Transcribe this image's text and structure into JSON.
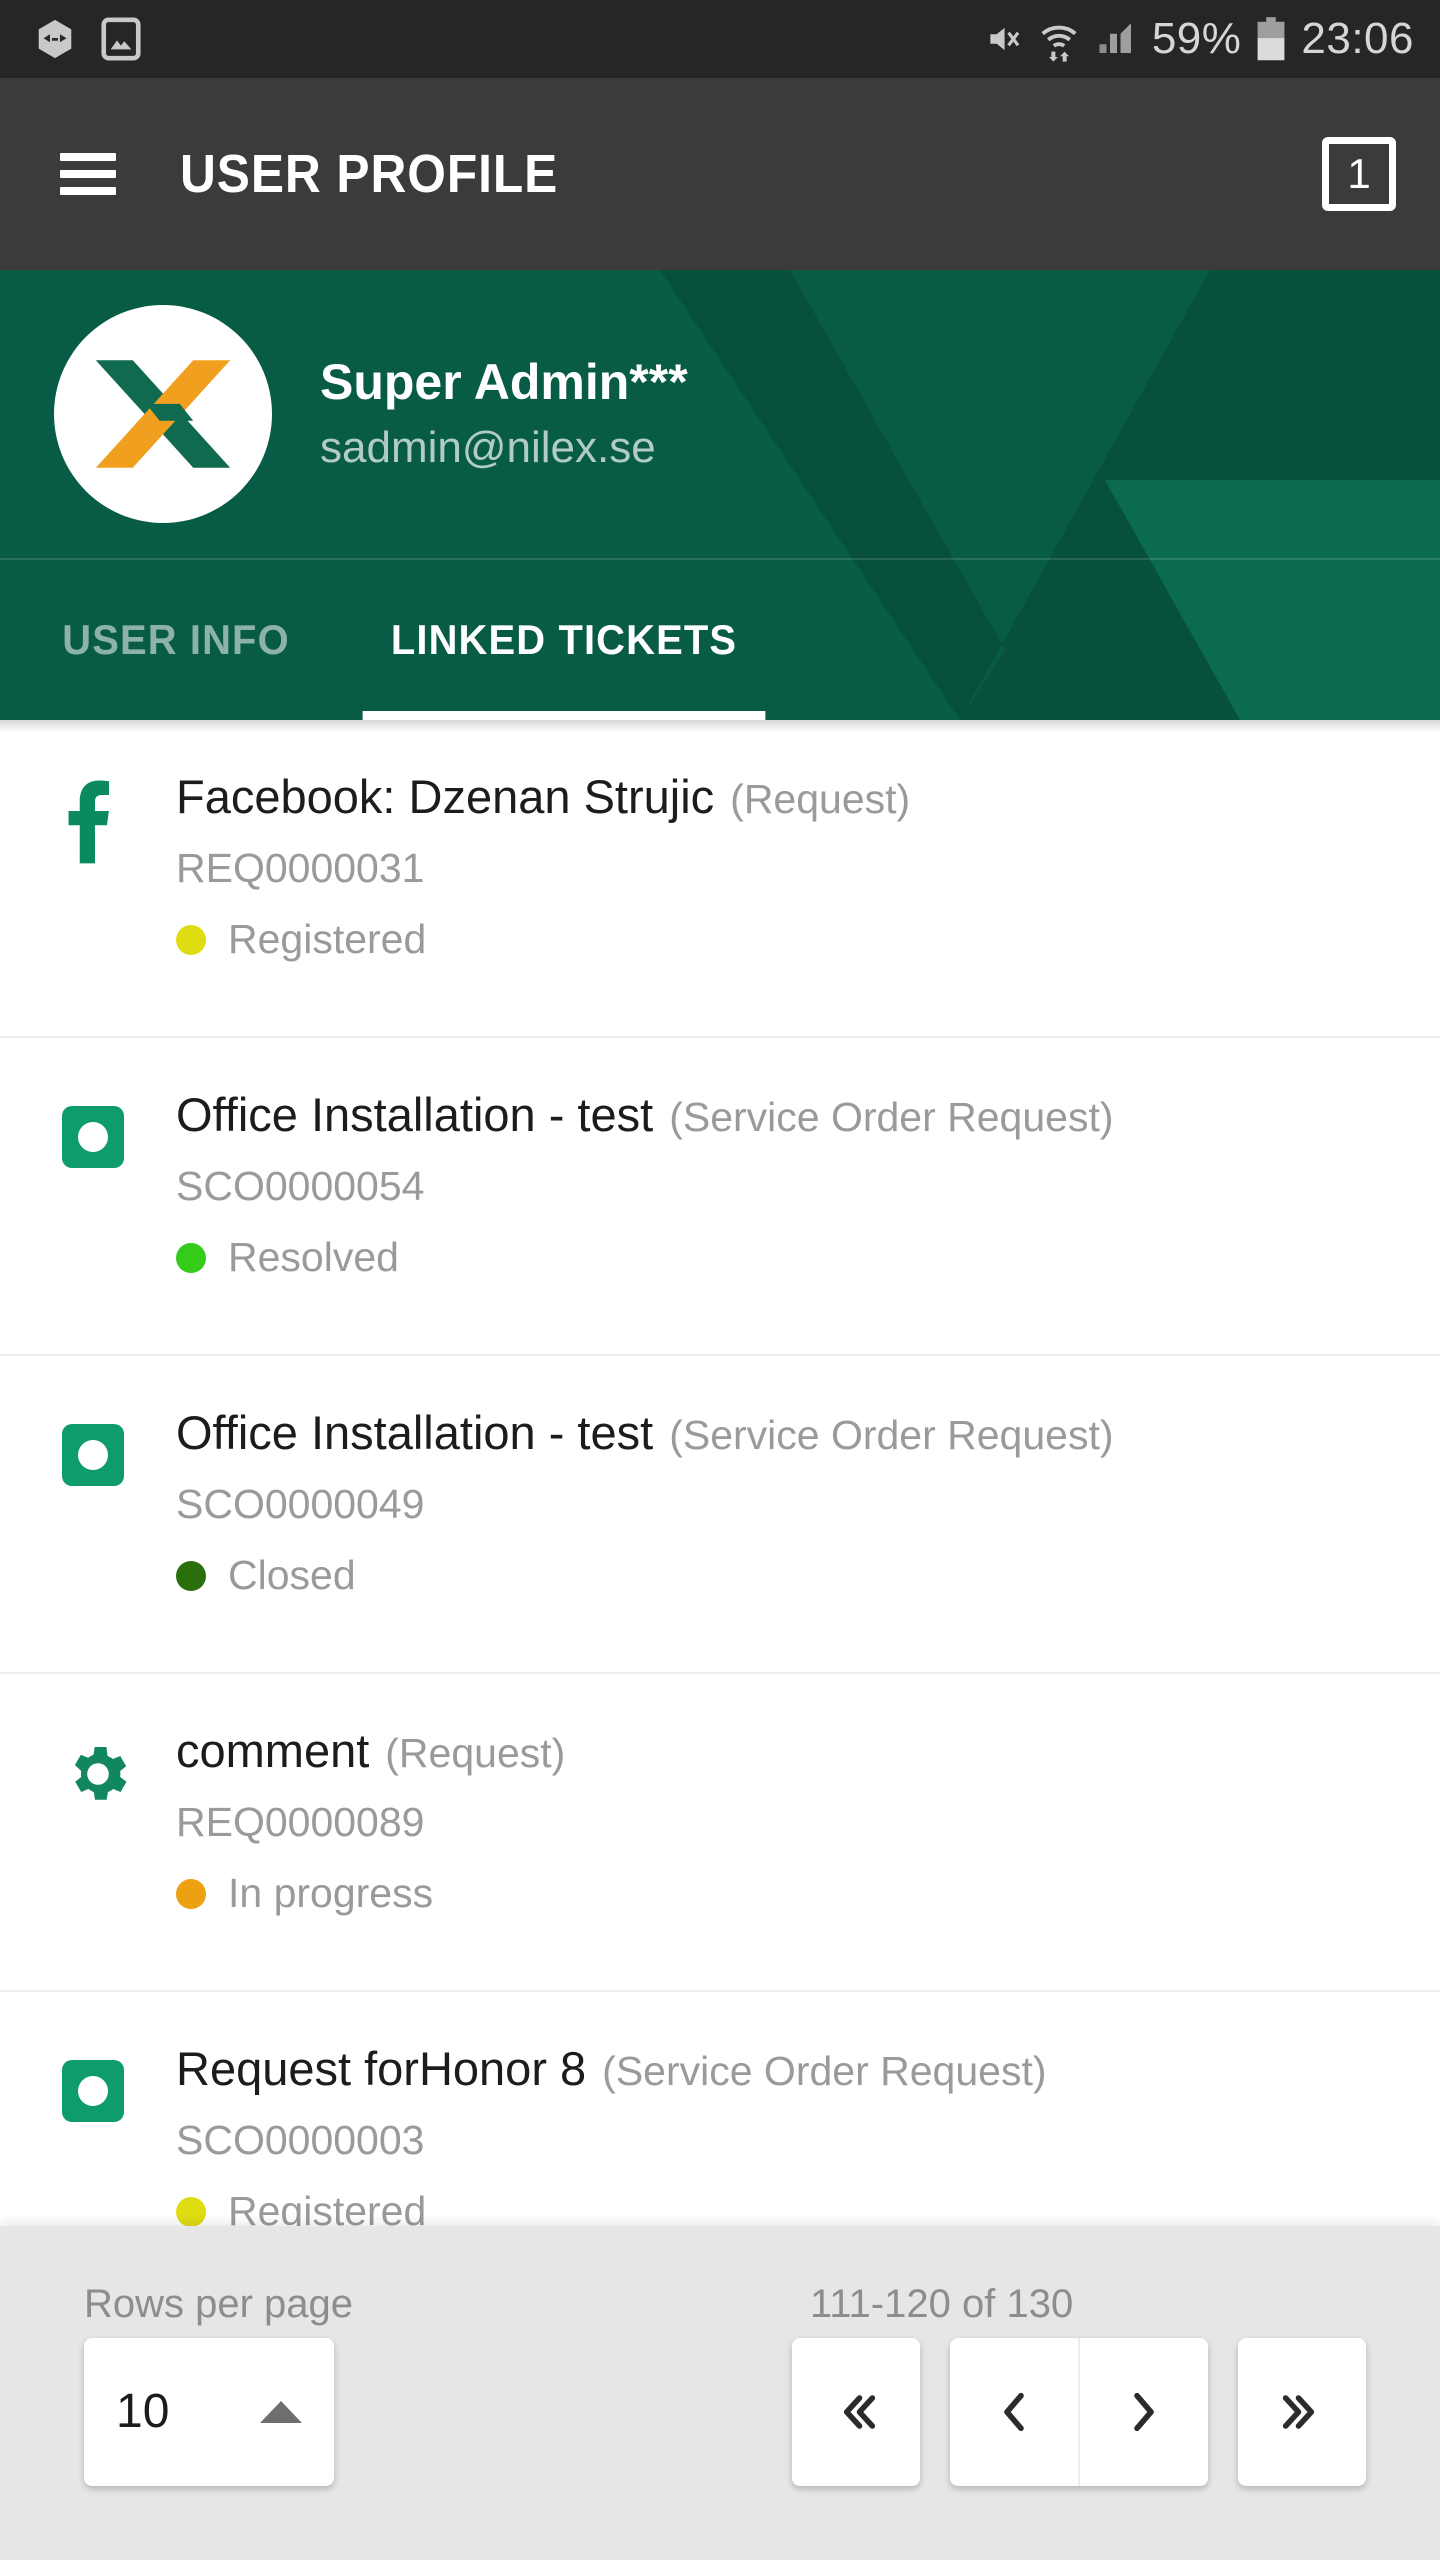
{
  "statusbar": {
    "icons_left": [
      "app-hexagon-icon",
      "gallery-image-icon"
    ],
    "icons_right": [
      "mute-vibrate-icon",
      "wifi-icon",
      "cellular-signal-icon",
      "battery-icon"
    ],
    "battery_percent": "59%",
    "time": "23:06"
  },
  "appbar": {
    "menu_icon": "hamburger-menu-icon",
    "title": "USER PROFILE",
    "recents_count": "1"
  },
  "profile": {
    "avatar_icon": "nilex-x-logo-avatar",
    "name": "Super Admin***",
    "email": "sadmin@nilex.se",
    "brand_green": "#085c45",
    "tabs": [
      {
        "label": "USER INFO",
        "active": false
      },
      {
        "label": "LINKED TICKETS",
        "active": true
      }
    ]
  },
  "tickets": [
    {
      "icon": "facebook-icon",
      "title": "Facebook: Dzenan Strujic",
      "type": "(Request)",
      "code": "REQ0000031",
      "status": "Registered",
      "status_color": "#e0dc12"
    },
    {
      "icon": "service-order-icon",
      "title": "Office Installation - test",
      "type": "(Service Order Request)",
      "code": "SCO0000054",
      "status": "Resolved",
      "status_color": "#35cb1b"
    },
    {
      "icon": "service-order-icon",
      "title": "Office Installation - test",
      "type": "(Service Order Request)",
      "code": "SCO0000049",
      "status": "Closed",
      "status_color": "#2a6f0c"
    },
    {
      "icon": "gear-icon",
      "title": "comment",
      "type": "(Request)",
      "code": "REQ0000089",
      "status": "In progress",
      "status_color": "#eda012"
    },
    {
      "icon": "service-order-icon",
      "title": "Request forHonor 8",
      "type": "(Service Order Request)",
      "code": "SCO0000003",
      "status": "Registered",
      "status_color": "#e0dc12"
    }
  ],
  "paginator": {
    "rows_per_page_label": "Rows per page",
    "rows_per_page_value": "10",
    "rows_per_page_caret": "caret-up-icon",
    "range_label": "111-120 of 130",
    "buttons": [
      {
        "name": "first-page",
        "icon": "double-chevron-left-icon"
      },
      {
        "name": "previous-page",
        "icon": "chevron-left-icon"
      },
      {
        "name": "next-page",
        "icon": "chevron-right-icon"
      },
      {
        "name": "last-page",
        "icon": "double-chevron-right-icon"
      }
    ]
  }
}
